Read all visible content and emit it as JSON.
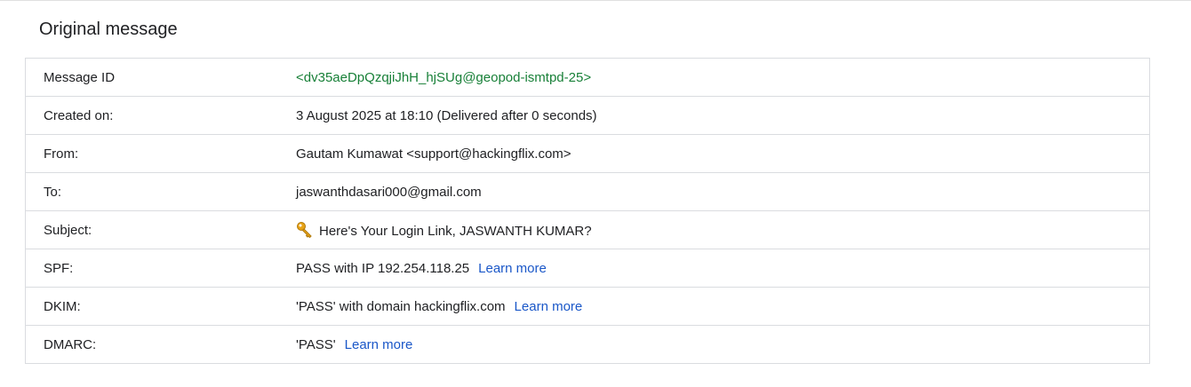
{
  "heading": "Original message",
  "rows": [
    {
      "label": "Message ID",
      "value": "<dv35aeDpQzqjiJhH_hjSUg@geopod-ismtpd-25>"
    },
    {
      "label": "Created on:",
      "value": "3 August 2025 at 18:10 (Delivered after 0 seconds)"
    },
    {
      "label": "From:",
      "value": "Gautam Kumawat <support@hackingflix.com>"
    },
    {
      "label": "To:",
      "value": "jaswanthdasari000@gmail.com"
    },
    {
      "label": "Subject:",
      "value": "Here's Your Login Link, JASWANTH KUMAR?",
      "icon": "key-icon"
    },
    {
      "label": "SPF:",
      "value": "PASS with IP 192.254.118.25",
      "link": "Learn more"
    },
    {
      "label": "DKIM:",
      "value": "'PASS' with domain hackingflix.com",
      "link": "Learn more"
    },
    {
      "label": "DMARC:",
      "value": "'PASS'",
      "link": "Learn more"
    }
  ],
  "colors": {
    "message_id": "#188038",
    "link": "#1a57c8",
    "border": "#dadce0"
  }
}
